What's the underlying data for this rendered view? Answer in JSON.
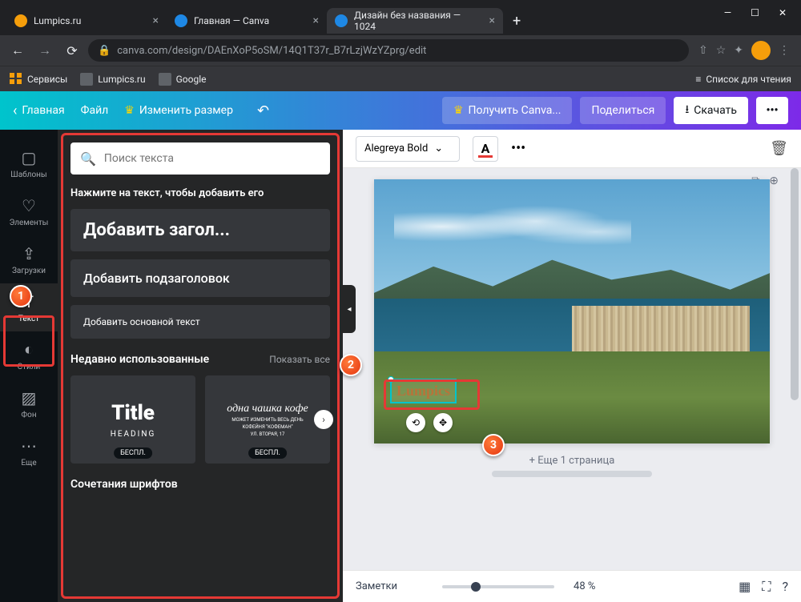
{
  "window": {
    "minimize": "—",
    "maximize": "☐",
    "close": "✕"
  },
  "tabs": [
    {
      "title": "Lumpics.ru",
      "active": false,
      "iconColor": "orange"
    },
    {
      "title": "Главная — Canva",
      "active": false,
      "iconColor": "blue"
    },
    {
      "title": "Дизайн без названия — 1024",
      "active": true,
      "iconColor": "blue"
    }
  ],
  "addressBar": {
    "url": "canva.com/design/DAEnXoP5oSM/14Q1T37r_B7rLzjWzYZprg/edit"
  },
  "bookmarks": {
    "services": "Сервисы",
    "lumpics": "Lumpics.ru",
    "google": "Google",
    "readingList": "Список для чтения"
  },
  "canvaHeader": {
    "home": "Главная",
    "file": "Файл",
    "resize": "Изменить размер",
    "getPro": "Получить Canva...",
    "share": "Поделиться",
    "download": "Скачать",
    "more": "•••"
  },
  "sidebar": {
    "items": [
      {
        "icon": "▢",
        "label": "Шаблоны"
      },
      {
        "icon": "♡",
        "label": "Элементы"
      },
      {
        "icon": "⇪",
        "label": "Загрузки"
      },
      {
        "icon": "T",
        "label": "Текст"
      },
      {
        "icon": "◐",
        "label": "Стили"
      },
      {
        "icon": "▨",
        "label": "Фон"
      },
      {
        "icon": "⋯",
        "label": "Еще"
      }
    ]
  },
  "textPanel": {
    "searchPlaceholder": "Поиск текста",
    "instruction": "Нажмите на текст, чтобы добавить его",
    "addHeading": "Добавить загол...",
    "addSubheading": "Добавить подзаголовок",
    "addBody": "Добавить основной текст",
    "recentTitle": "Недавно использованные",
    "showAll": "Показать все",
    "tmpl1": {
      "title": "Title",
      "sub": "HEADING"
    },
    "tmpl2": {
      "script": "одна чашка кофе",
      "small1": "МОЖЕТ ИЗМЕНИТЬ ВЕСЬ ДЕНЬ",
      "small2": "КОФЕЙНЯ \"КОФЕМАН\"",
      "small3": "УЛ. ВТОРАЯ, 17"
    },
    "freeBadge": "БЕСПЛ.",
    "combinations": "Сочетания шрифтов"
  },
  "canvasToolbar": {
    "font": "Alegreya Bold",
    "colorLetter": "A"
  },
  "canvas": {
    "textElement": "Lumpics",
    "addPage": "+ Еще 1 страница"
  },
  "bottomBar": {
    "notes": "Заметки",
    "zoom": "48 %"
  },
  "callouts": {
    "c1": "1",
    "c2": "2",
    "c3": "3"
  }
}
